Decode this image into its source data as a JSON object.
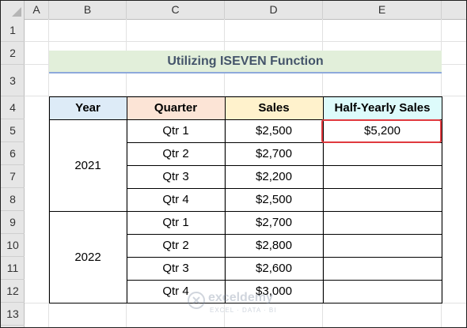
{
  "columns": [
    "A",
    "B",
    "C",
    "D",
    "E"
  ],
  "rows": [
    "1",
    "2",
    "3",
    "4",
    "5",
    "6",
    "7",
    "8",
    "9",
    "10",
    "11",
    "12",
    "13"
  ],
  "title": "Utilizing ISEVEN Function",
  "headers": {
    "year": "Year",
    "quarter": "Quarter",
    "sales": "Sales",
    "half_yearly": "Half-Yearly Sales"
  },
  "years": [
    "2021",
    "2022"
  ],
  "table": [
    {
      "quarter": "Qtr 1",
      "sales": "$2,500",
      "half_yearly": "$5,200"
    },
    {
      "quarter": "Qtr 2",
      "sales": "$2,700",
      "half_yearly": ""
    },
    {
      "quarter": "Qtr 3",
      "sales": "$2,200",
      "half_yearly": ""
    },
    {
      "quarter": "Qtr 4",
      "sales": "$2,500",
      "half_yearly": ""
    },
    {
      "quarter": "Qtr 1",
      "sales": "$2,700",
      "half_yearly": ""
    },
    {
      "quarter": "Qtr 2",
      "sales": "$2,800",
      "half_yearly": ""
    },
    {
      "quarter": "Qtr 3",
      "sales": "$2,600",
      "half_yearly": ""
    },
    {
      "quarter": "Qtr 4",
      "sales": "$3,000",
      "half_yearly": ""
    }
  ],
  "colors": {
    "year_header": "#ddebf7",
    "quarter_header": "#fce4d6",
    "sales_header": "#fff2cc",
    "half_header": "#ddfbfb",
    "title_fill": "#e2efda",
    "selection": "#e0393e"
  },
  "watermark": {
    "name": "exceldemy",
    "tagline": "EXCEL · DATA · BI",
    "icon": "exceldemy-logo-icon"
  }
}
